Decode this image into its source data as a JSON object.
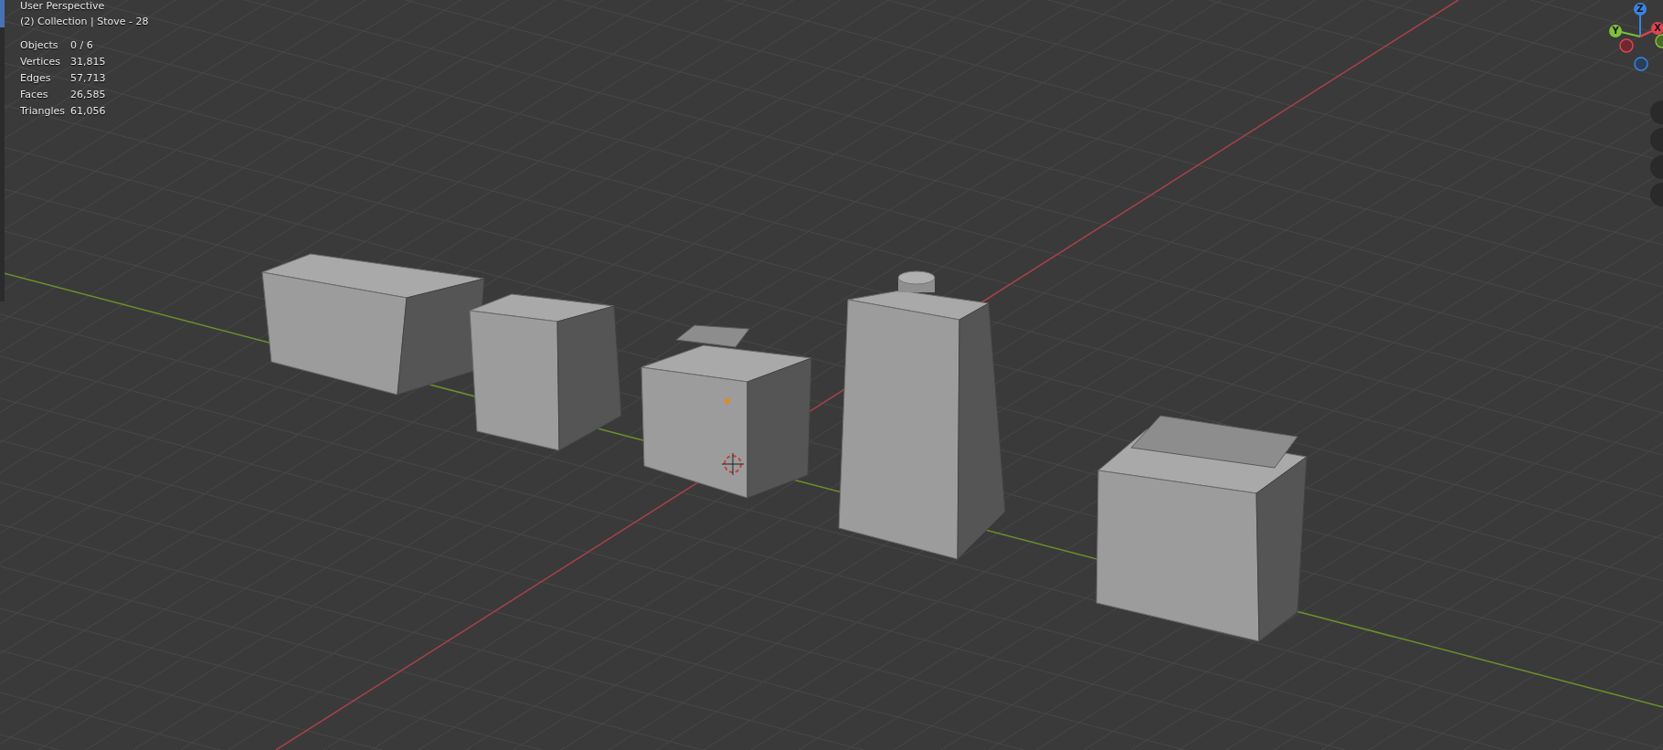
{
  "viewport": {
    "view_name": "User Perspective",
    "collection_label": "(2) Collection | Stove - 28",
    "stats": [
      {
        "label": "Objects",
        "value": "0 / 6"
      },
      {
        "label": "Vertices",
        "value": "31,815"
      },
      {
        "label": "Edges",
        "value": "57,713"
      },
      {
        "label": "Faces",
        "value": "26,585"
      },
      {
        "label": "Triangles",
        "value": "61,056"
      }
    ],
    "gizmo_axes": [
      {
        "label": "Z",
        "color": "#3b83e0"
      },
      {
        "label": "Y",
        "color": "#7fc13a"
      },
      {
        "label": "X",
        "color": "#e2424f"
      }
    ]
  }
}
